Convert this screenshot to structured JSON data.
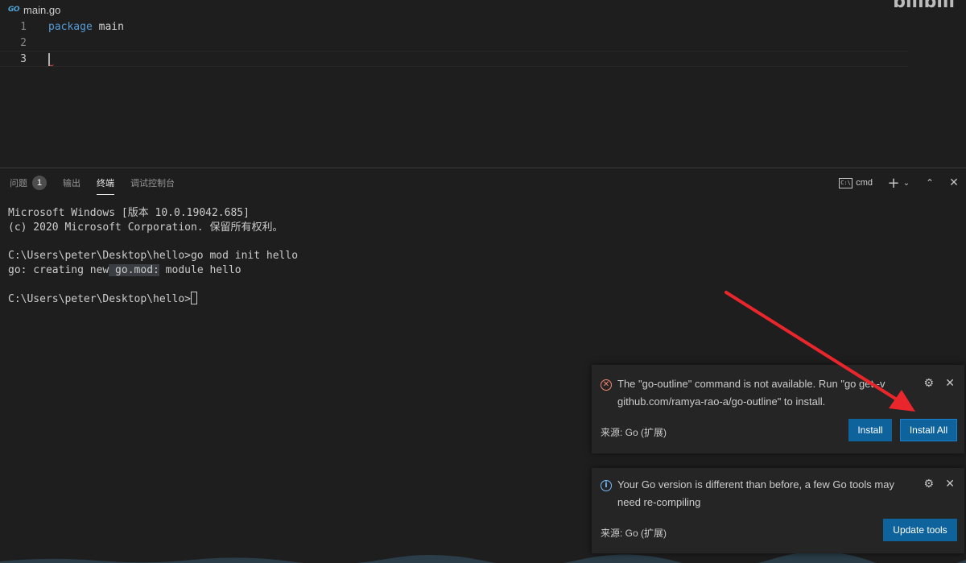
{
  "editor": {
    "tab_title": "main.go",
    "tab_icon": "GO",
    "watermark": "bilibili",
    "lines": [
      {
        "number": "1",
        "keyword": "package",
        "ident": "main"
      },
      {
        "number": "2",
        "keyword": "",
        "ident": ""
      },
      {
        "number": "3",
        "keyword": "",
        "ident": ""
      }
    ]
  },
  "panel": {
    "tabs": [
      {
        "label": "问题",
        "badge": "1"
      },
      {
        "label": "输出"
      },
      {
        "label": "终端"
      },
      {
        "label": "调试控制台"
      }
    ],
    "terminal_selector": "cmd",
    "terminal_glyph": "C:\\"
  },
  "terminal": {
    "line1": "Microsoft Windows [版本 10.0.19042.685]",
    "line2": "(c) 2020 Microsoft Corporation. 保留所有权利。",
    "line3": "C:\\Users\\peter\\Desktop\\hello>go mod init hello",
    "line4_prefix": "go: creating new",
    "line4_highlight": " go.mod:",
    "line4_suffix": " module hello",
    "line5": "C:\\Users\\peter\\Desktop\\hello>"
  },
  "notifications": [
    {
      "message": "The \"go-outline\" command is not available. Run \"go get -v github.com/ramya-rao-a/go-outline\" to install.",
      "source": "来源: Go (扩展)",
      "buttons": [
        "Install",
        "Install All"
      ]
    },
    {
      "message": "Your Go version is different than before, a few Go tools may need re-compiling",
      "source": "来源: Go (扩展)",
      "buttons": [
        "Update tools"
      ]
    }
  ],
  "colors": {
    "accent_button": "#0e639c",
    "error_icon": "#f48771",
    "info_icon": "#75beff",
    "annotation_arrow": "#e8262b"
  }
}
